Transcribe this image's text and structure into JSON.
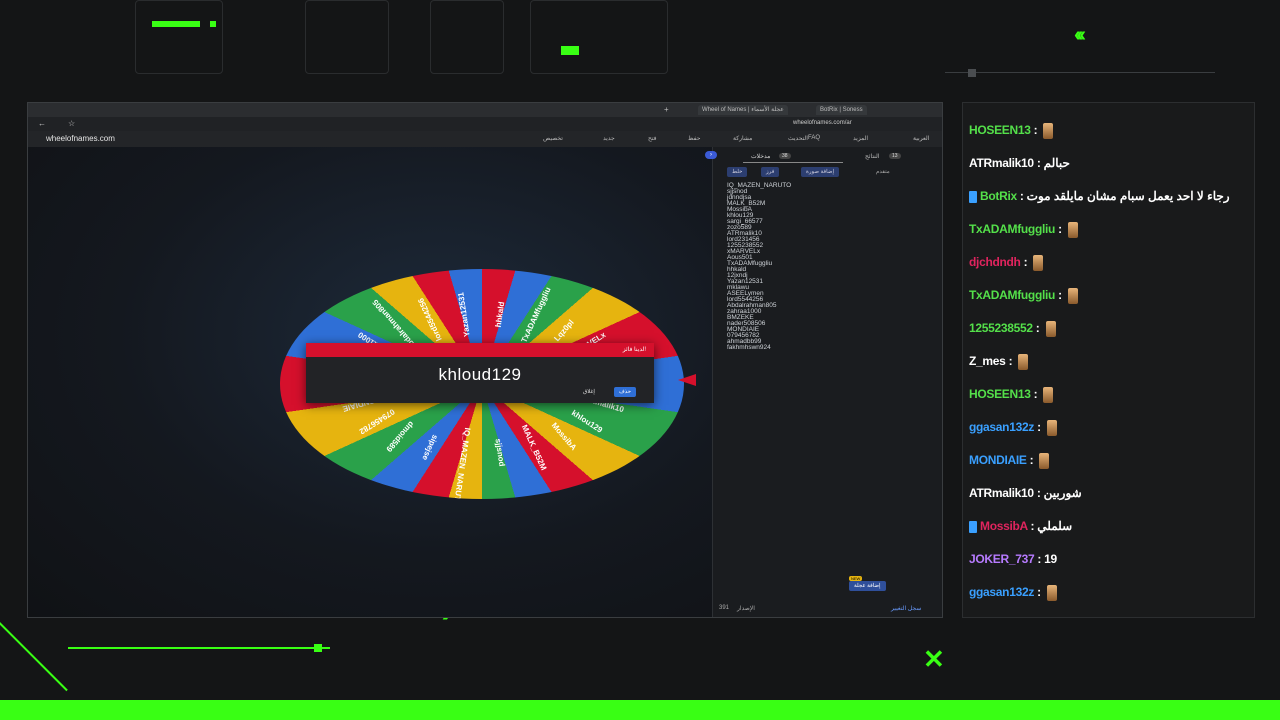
{
  "browser": {
    "tabs": [
      "Wheel of Names | عجلة الأسماء",
      "BotRix | Soness"
    ],
    "url": "wheelofnames.com/ar",
    "site_name": "wheelofnames.com",
    "nav_items": [
      "العربية",
      "المزيد",
      "FAQ",
      "التحديث",
      "مشاركة",
      "حفظ",
      "فتح",
      "جديد",
      "تخصيص"
    ]
  },
  "wheel": {
    "segment_labels": [
      "hhkald",
      "TxADAMfuggliu",
      "Lqz0pl",
      "xMARVELx",
      "1255238552",
      "lord231456",
      "ATRmalik10",
      "khlou129",
      "MossibA",
      "MALK_B52M",
      "sjjsnod",
      "IQ_MAZEN_NARUTO",
      "sipejse",
      "dmoid589",
      "079456782",
      "MONDIAIE",
      "nader508506",
      "BMZEKE",
      "zahraa1000",
      "Abdalrahman805",
      "lord5544256",
      "Yazan12531"
    ],
    "colors": [
      "#d5102c",
      "#2f6fd6",
      "#2aa14a",
      "#e6b40f"
    ]
  },
  "winner": {
    "title": "لدينا فائز!",
    "name": "khloud129",
    "close_label": "إغلاق",
    "remove_label": "حذف"
  },
  "panel": {
    "tab_entries": "مدخلات",
    "entries_count": "38",
    "tab_results": "النتائج",
    "results_count": "13",
    "shuffle": "خلط",
    "sort": "فرز",
    "add_image": "إضافة صورة",
    "advanced": "متقدم",
    "entries": [
      "IQ_MAZEN_NARUTO",
      "sjjsnod",
      "jdnndjsa",
      "MALK_B52M",
      "MossibA",
      "khlou129",
      "sargi_66577",
      "zozo589",
      "ATRmalik10",
      "lord231456",
      "1255238552",
      "xMARVELx",
      "Aous501",
      "TxADAMfuggliu",
      "hhkald",
      "12jxndj",
      "Yazan12531",
      "mklawu",
      "ASEELymen",
      "lord5544256",
      "Abdalrahman805",
      "zahraa1000",
      "BMZEKE",
      "nader508506",
      "MONDIAIE",
      "079456782",
      "ahmadbb99",
      "fakhmhswn924"
    ],
    "add_wheel_button": "إضافة عجلة",
    "new_badge": "NEW",
    "version_label": "الإصدار",
    "version": "391",
    "changelog_link": "سجل التغيير"
  },
  "chat": {
    "messages": [
      {
        "user": "HOSEEN13",
        "text": "",
        "emote": true,
        "color": "#54e04a"
      },
      {
        "user": "ATRmalik10",
        "text": "حبالم",
        "emote": false,
        "color": "#ffffff"
      },
      {
        "user": "BotRix",
        "text": "رجاء لا احد يعمل سبام مشان مايلقد موت",
        "emote": false,
        "color": "#54e04a",
        "badge": true
      },
      {
        "user": "TxADAMfuggliu",
        "text": "",
        "emote": true,
        "color": "#54e04a"
      },
      {
        "user": "djchdndh",
        "text": "",
        "emote": true,
        "color": "#e0245e"
      },
      {
        "user": "TxADAMfuggliu",
        "text": "",
        "emote": true,
        "color": "#54e04a"
      },
      {
        "user": "1255238552",
        "text": "",
        "emote": true,
        "color": "#54e04a"
      },
      {
        "user": "Z_mes",
        "text": "",
        "emote": true,
        "color": "#ffffff"
      },
      {
        "user": "HOSEEN13",
        "text": "",
        "emote": true,
        "color": "#54e04a"
      },
      {
        "user": "ggasan132z",
        "text": "",
        "emote": true,
        "color": "#3aa0ff"
      },
      {
        "user": "MONDIAIE",
        "text": "",
        "emote": true,
        "color": "#3aa0ff"
      },
      {
        "user": "ATRmalik10",
        "text": "شوربين",
        "emote": false,
        "color": "#ffffff"
      },
      {
        "user": "MossibA",
        "text": "سلملي",
        "emote": false,
        "color": "#e0245e",
        "badge": true
      },
      {
        "user": "JOKER_737",
        "text": "19",
        "emote": false,
        "color": "#b77bff"
      },
      {
        "user": "ggasan132z",
        "text": "",
        "emote": true,
        "color": "#3aa0ff"
      }
    ]
  }
}
